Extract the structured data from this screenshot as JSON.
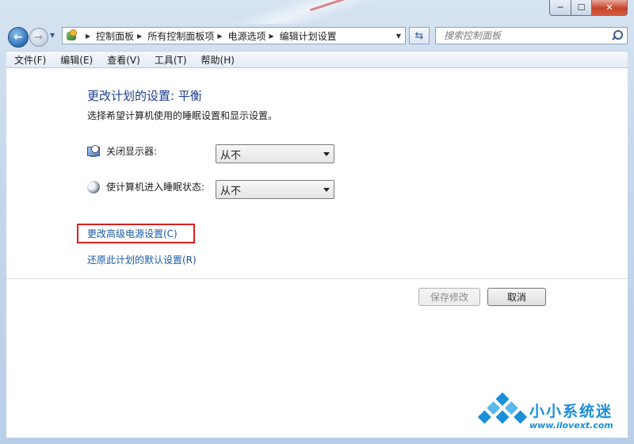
{
  "window": {
    "minimize_glyph": "─",
    "maximize_glyph": "☐",
    "close_glyph": "✕"
  },
  "nav": {
    "back_glyph": "←",
    "forward_glyph": "→",
    "dropdown_glyph": "▼",
    "breadcrumbs": [
      "控制面板",
      "所有控制面板项",
      "电源选项",
      "编辑计划设置"
    ],
    "refresh_glyph": "⇆",
    "search_placeholder": "搜索控制面板"
  },
  "menu": [
    "文件(F)",
    "编辑(E)",
    "查看(V)",
    "工具(T)",
    "帮助(H)"
  ],
  "content": {
    "title": "更改计划的设置: 平衡",
    "subtitle": "选择希望计算机使用的睡眠设置和显示设置。",
    "settings": [
      {
        "label": "关闭显示器:",
        "value": "从不",
        "icon": "monitor-clock-icon"
      },
      {
        "label": "使计算机进入睡眠状态:",
        "value": "从不",
        "icon": "sleep-moon-icon"
      }
    ],
    "advanced_link": "更改高级电源设置(C)",
    "restore_link": "还原此计划的默认设置(R)",
    "save_button": "保存修改",
    "cancel_button": "取消"
  },
  "watermark": {
    "name": "小小系统迷",
    "url": "www.ilovext.com"
  },
  "colors": {
    "title": "#1e3d8f",
    "link": "#1a5aa3",
    "highlight_box": "#d8201d",
    "watermark": "#1a8fd8"
  }
}
